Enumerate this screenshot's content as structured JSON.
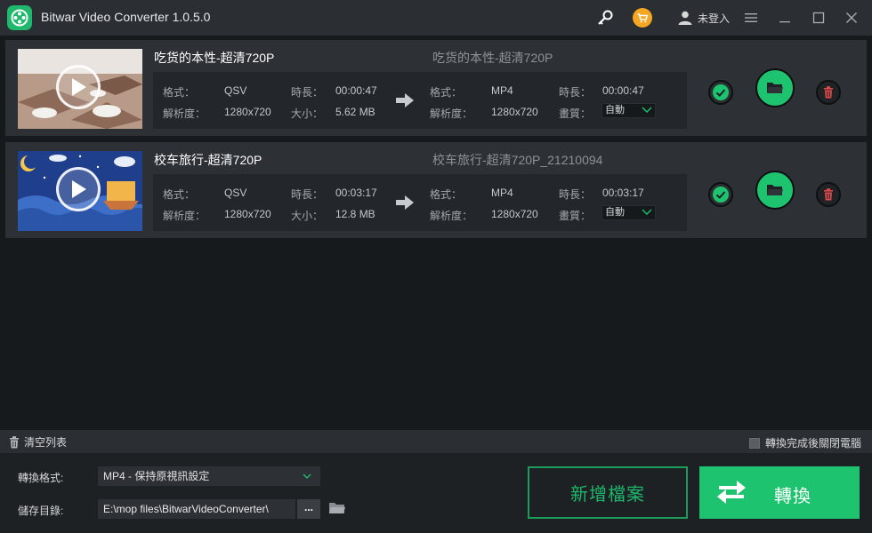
{
  "app": {
    "title": "Bitwar Video Converter  1.0.5.0",
    "user_label": "未登入",
    "icons": [
      "logo-icon",
      "key-icon",
      "cart-icon",
      "user-icon",
      "menu-icon",
      "minimize-icon",
      "maximize-icon",
      "close-icon"
    ],
    "accent_color": "#1ec36f",
    "cart_color": "#f5a623"
  },
  "labels": {
    "format": "格式：",
    "duration": "時長：",
    "resolution": "解析度：",
    "size": "大小：",
    "quality": "畫質："
  },
  "files": [
    {
      "source_name": "吃货的本性-超清720P",
      "output_name": "吃货的本性-超清720P",
      "source": {
        "format": "QSV",
        "duration": "00:00:47",
        "resolution": "1280x720",
        "size": "5.62 MB"
      },
      "output": {
        "format": "MP4",
        "duration": "00:00:47",
        "resolution": "1280x720",
        "quality": "自動"
      }
    },
    {
      "source_name": "校车旅行-超清720P",
      "output_name": "校车旅行-超清720P_21210094",
      "source": {
        "format": "QSV",
        "duration": "00:03:17",
        "resolution": "1280x720",
        "size": "12.8 MB"
      },
      "output": {
        "format": "MP4",
        "duration": "00:03:17",
        "resolution": "1280x720",
        "quality": "自動"
      }
    }
  ],
  "toolbar": {
    "clear_label": "清空列表",
    "shutdown_label": "轉換完成後關閉電腦"
  },
  "bottom": {
    "format_label": "轉換格式:",
    "format_value": "MP4 - 保持原視訊設定",
    "dir_label": "儲存目錄:",
    "dir_value": "E:\\mop files\\BitwarVideoConverter\\",
    "browse_label": "...",
    "add_label": "新增檔案",
    "convert_label": "轉換"
  }
}
